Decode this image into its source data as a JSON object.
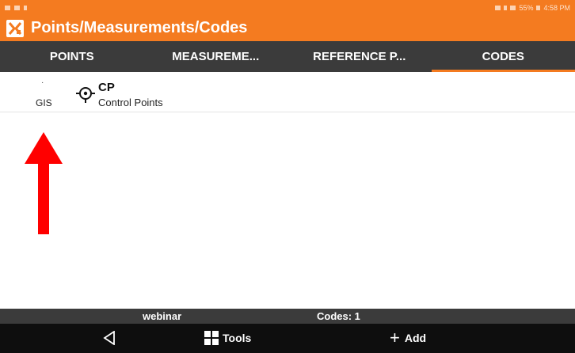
{
  "status_bar": {
    "right_text": "55%",
    "time": "4:58 PM"
  },
  "app": {
    "title": "Points/Measurements/Codes",
    "accent_color": "#f47b20",
    "logo_icon": "app-logo-icon"
  },
  "tabs": [
    {
      "label": "POINTS",
      "active": false
    },
    {
      "label": "MEASUREME...",
      "active": false
    },
    {
      "label": "REFERENCE P...",
      "active": false
    },
    {
      "label": "CODES",
      "active": true
    }
  ],
  "codes": [
    {
      "dot": "·",
      "group": "GIS",
      "icon": "crosshair-point-icon",
      "name": "CP",
      "description": "Control Points"
    }
  ],
  "annotation": {
    "icon": "red-arrow-up-icon",
    "color": "#ff0000"
  },
  "info_bar": {
    "project": "webinar",
    "codes_count": "Codes: 1"
  },
  "bottom_nav": {
    "back_icon": "back-triangle-icon",
    "tools_label": "Tools",
    "tools_icon": "grid-icon",
    "add_label": "Add",
    "add_icon": "plus-icon"
  }
}
